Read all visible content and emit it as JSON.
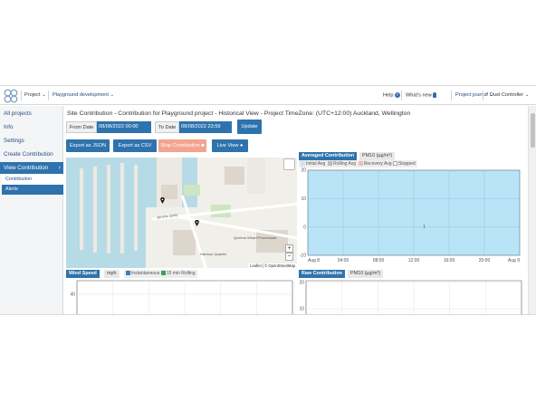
{
  "header": {
    "project_label": "Project",
    "project_name": "Playground development",
    "help": "Help",
    "whats_new": "What's new",
    "project_journal": "Project journal",
    "user": "Dust Controller"
  },
  "sidebar": {
    "items": [
      {
        "label": "All projects"
      },
      {
        "label": "Info"
      },
      {
        "label": "Settings"
      },
      {
        "label": "Create Contribution"
      },
      {
        "label": "View Contribution"
      }
    ],
    "sub_items": [
      {
        "label": "Contribution"
      },
      {
        "label": "Alerts"
      }
    ]
  },
  "page": {
    "title": "Site Contribution - Contribution for Playground project - Historical View - Project TimeZone: (UTC+12:00) Auckland, Wellington",
    "from_label": "From Date",
    "from_value": "08/08/2022 00:00",
    "to_label": "To Date",
    "to_value": "08/08/2022 23:59",
    "update": "Update",
    "export_json": "Export as JSON",
    "export_csv": "Export as CSV",
    "stop_contribution": "Stop Contribution",
    "live_view": "Live View"
  },
  "map": {
    "attribution": "Leaflet | © OpenStreetMap",
    "zoom_in": "+",
    "zoom_out": "−",
    "street_labels": [
      "Jervois Quay",
      "Queens Wharf Promenade",
      "Harbour Quarter"
    ]
  },
  "averaged_chart": {
    "tab_active": "Averaged Contribution",
    "tab_metric": "PM10 (µg/m³)",
    "legend": [
      "Initial Avg",
      "Rolling Avg",
      "Recovery Avg",
      "Stopped"
    ],
    "legend_colors": [
      "#cfe3f3",
      "#bbbbbb",
      "#f4b9b9",
      "#ffffff"
    ],
    "y_ticks": [
      "20",
      "10",
      "0",
      "-10"
    ],
    "x_ticks": [
      "Aug 8",
      "04:00",
      "08:00",
      "12:00",
      "16:00",
      "20:00",
      "Aug 9"
    ],
    "marker": "1",
    "fill_color": "#b9e4f7"
  },
  "wind_chart": {
    "tab_active": "Wind Speed",
    "unit": "mph",
    "legend": [
      "Instantaneous",
      "15 min Rolling"
    ],
    "legend_colors": [
      "#3f7fb6",
      "#3aa15b"
    ],
    "y_ticks": [
      "40"
    ]
  },
  "raw_chart": {
    "tab_active": "Raw Contribution",
    "tab_metric": "PM10 (µg/m³)",
    "y_ticks": [
      "20",
      "10"
    ]
  },
  "chart_data": {
    "type": "area",
    "title": "Averaged Contribution",
    "ylabel": "PM10 (µg/m³)",
    "categories": [
      "Aug 8",
      "04:00",
      "08:00",
      "12:00",
      "16:00",
      "20:00",
      "Aug 9"
    ],
    "series": [
      {
        "name": "Initial Avg",
        "values": []
      },
      {
        "name": "Rolling Avg",
        "values": []
      },
      {
        "name": "Recovery Avg",
        "values": []
      },
      {
        "name": "Stopped",
        "values": []
      }
    ],
    "ylim": [
      -10,
      20
    ],
    "grid": true
  }
}
